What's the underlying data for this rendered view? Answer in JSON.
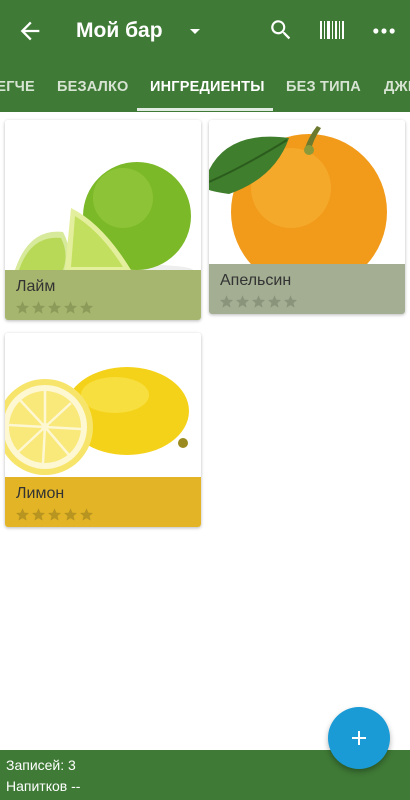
{
  "appbar": {
    "title": "Мой бар",
    "icons": [
      "back-arrow-icon",
      "dropdown-icon",
      "search-icon",
      "barcode-icon",
      "more-icon"
    ]
  },
  "tabs": [
    {
      "label": "ЛЕГЧЕ",
      "active": false
    },
    {
      "label": "БЕЗАЛКО",
      "active": false
    },
    {
      "label": "ИНГРЕДИЕНТЫ",
      "active": true
    },
    {
      "label": "БЕЗ ТИПА",
      "active": false
    },
    {
      "label": "ДЖИН",
      "active": false
    }
  ],
  "cards": [
    {
      "name": "Лайм",
      "rating_stars": 5,
      "rating_filled": 0,
      "color": "#a7b66e"
    },
    {
      "name": "Апельсин",
      "rating_stars": 5,
      "rating_filled": 0,
      "color": "#a3ae93"
    },
    {
      "name": "Лимон",
      "rating_stars": 5,
      "rating_filled": 0,
      "color": "#e3b526"
    }
  ],
  "footer": {
    "records": "Записей: 3",
    "drinks": "Напитков --"
  },
  "colors": {
    "primary": "#3f7a36",
    "fab": "#1a9bd5"
  }
}
